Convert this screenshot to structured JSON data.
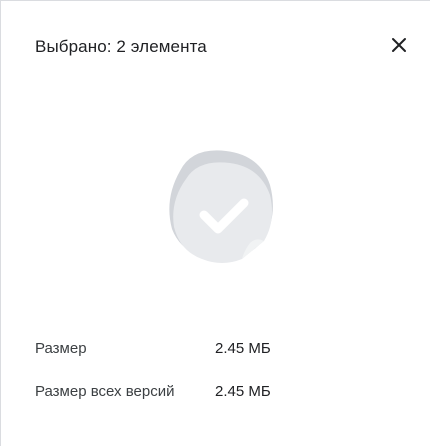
{
  "header": {
    "title": "Выбрано: 2 элемента",
    "close_icon": "close-icon"
  },
  "illustration": {
    "icon": "multi-select-check-icon",
    "colors": {
      "back_sheet": "#d2d5da",
      "front_sheet": "#e8eaed",
      "curl": "#f1f3f4",
      "check": "#ffffff"
    }
  },
  "details": [
    {
      "label": "Размер",
      "value": "2.45 МБ"
    },
    {
      "label": "Размер всех версий",
      "value": "2.45 МБ"
    }
  ]
}
